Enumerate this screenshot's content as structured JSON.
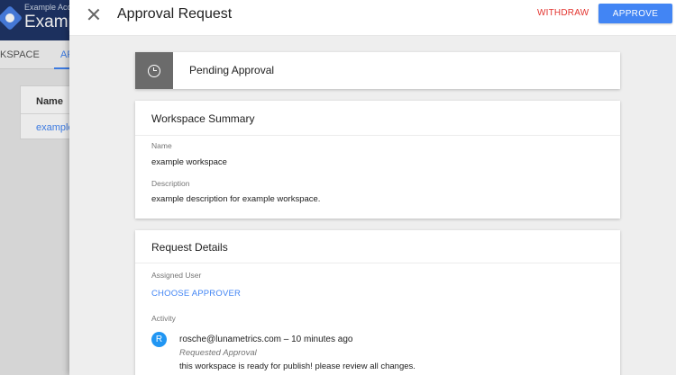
{
  "background": {
    "account_name": "Example Acc",
    "container_name": "Exampl",
    "tabs": [
      "KSPACE",
      "AP"
    ],
    "table_header": "Name",
    "table_row": "example"
  },
  "dialog": {
    "title": "Approval Request",
    "withdraw_label": "WITHDRAW",
    "approve_label": "APPROVE",
    "status": {
      "label": "Pending Approval",
      "icon": "clock-icon"
    },
    "summary": {
      "title": "Workspace Summary",
      "name_label": "Name",
      "name_value": "example workspace",
      "description_label": "Description",
      "description_value": "example description for example workspace."
    },
    "details": {
      "title": "Request Details",
      "assigned_user_label": "Assigned User",
      "choose_approver_label": "CHOOSE APPROVER",
      "activity_label": "Activity",
      "activity": {
        "avatar_letter": "R",
        "user_line": "rosche@lunametrics.com – 10 minutes ago",
        "type": "Requested Approval",
        "message": "this workspace is ready for publish! please review all changes."
      }
    }
  },
  "colors": {
    "accent": "#4285f4",
    "danger": "#e3342f",
    "status_box": "#6b6b6b",
    "avatar": "#2196f3",
    "header": "#1f3566"
  }
}
